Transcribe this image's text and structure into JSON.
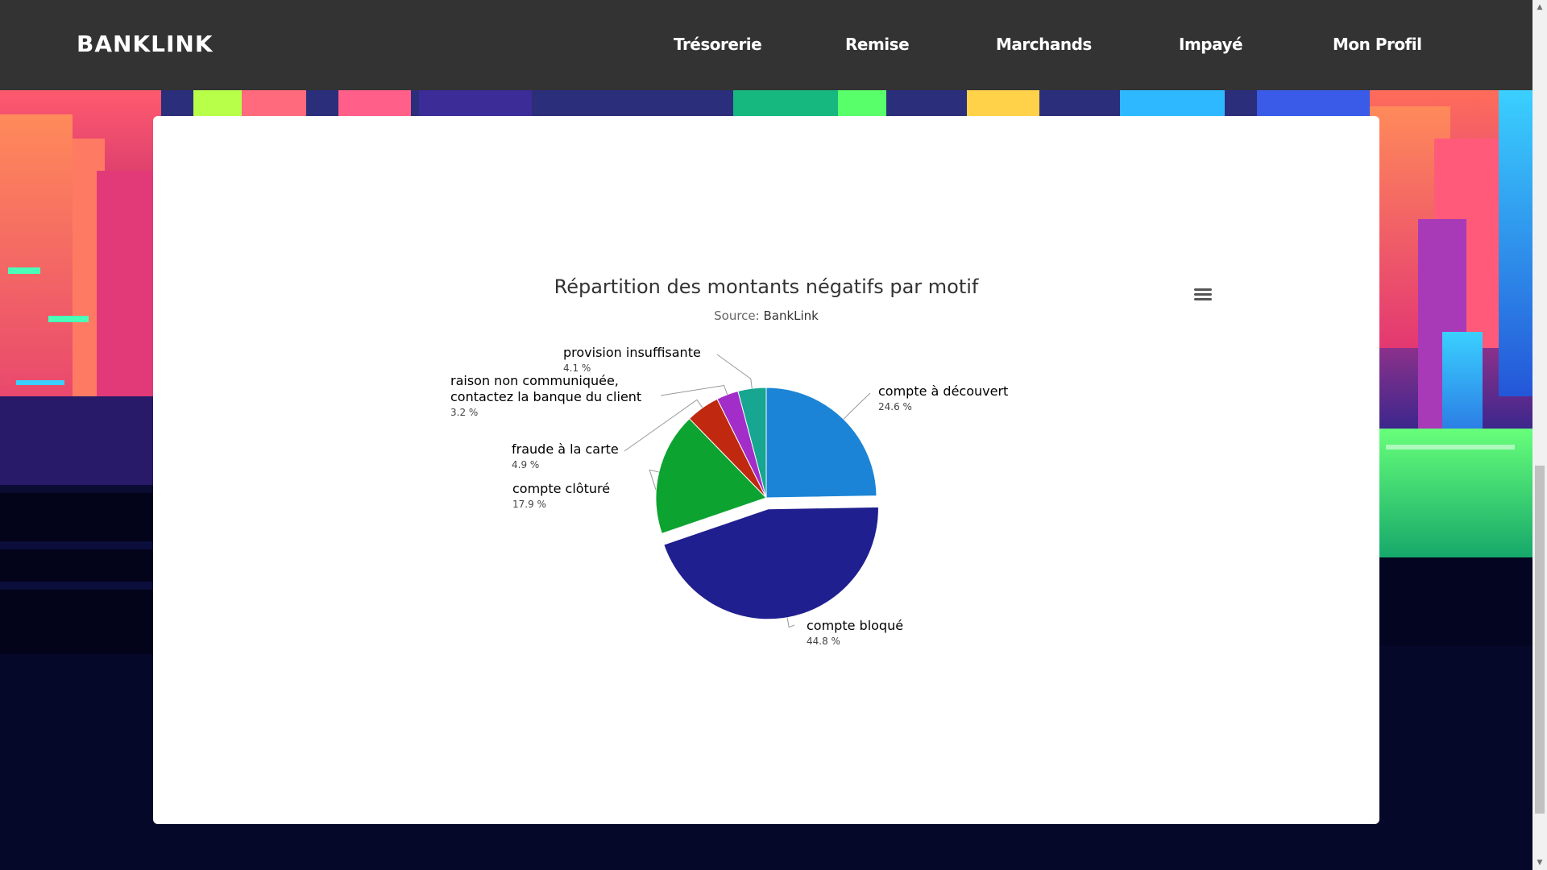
{
  "app": {
    "logo": "BANKLINK"
  },
  "nav": {
    "items": [
      {
        "label": "Trésorerie"
      },
      {
        "label": "Remise"
      },
      {
        "label": "Marchands"
      },
      {
        "label": "Impayé"
      },
      {
        "label": "Mon Profil"
      }
    ]
  },
  "card": {
    "menu_icon": "hamburger-menu-icon"
  },
  "colors": {
    "navbar": "#333333",
    "page_background": "#060a2e"
  },
  "chart_data": {
    "type": "pie",
    "title": "Répartition des montants négatifs par motif",
    "subtitle_prefix": "Source: ",
    "subtitle_source": "BankLink",
    "slices": [
      {
        "name": "compte à découvert",
        "value": 24.6,
        "pct_label": "24.6 %",
        "color": "#1b84d6"
      },
      {
        "name": "compte bloqué",
        "value": 44.8,
        "pct_label": "44.8 %",
        "color": "#1f1f8f",
        "sliced": true
      },
      {
        "name": "compte clôturé",
        "value": 17.9,
        "pct_label": "17.9 %",
        "color": "#0da330"
      },
      {
        "name": "fraude à la carte",
        "value": 4.9,
        "pct_label": "4.9 %",
        "color": "#c0280f"
      },
      {
        "name": "raison non communiquée,|contactez la banque du client",
        "value": 3.2,
        "pct_label": "3.2 %",
        "color": "#a32dc8"
      },
      {
        "name": "provision insuffisante",
        "value": 4.1,
        "pct_label": "4.1 %",
        "color": "#17a68f"
      }
    ]
  }
}
